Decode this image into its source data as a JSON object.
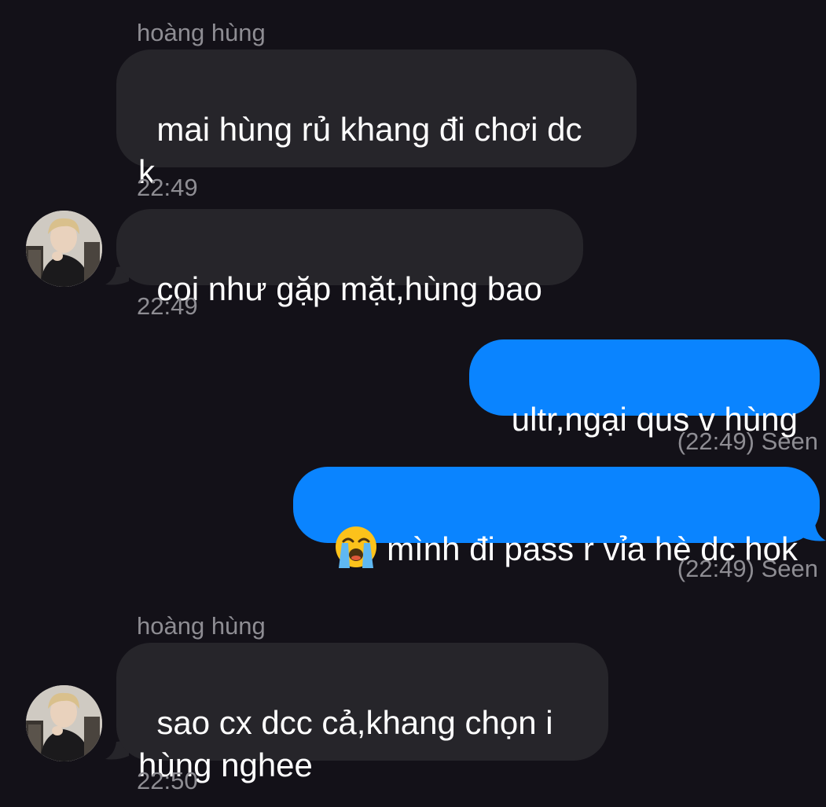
{
  "colors": {
    "background": "#131118",
    "incoming_bubble": "#26252a",
    "outgoing_bubble": "#0a84ff",
    "meta_text": "#8e8d93"
  },
  "messages": [
    {
      "sender": "hoàng hùng",
      "text": "mai hùng rủ khang đi chơi dc\nk",
      "time": "22:49",
      "direction": "incoming"
    },
    {
      "text": "coi như gặp mặt,hùng bao",
      "time": "22:49",
      "direction": "incoming",
      "avatar": "profile-photo"
    },
    {
      "text": "ultr,ngại qus v hùng",
      "status": "(22:49) Seen",
      "direction": "outgoing"
    },
    {
      "emoji": "loudly-crying-face-icon",
      "text": "mình đi pass r vỉa hè dc hok",
      "status": "(22:49) Seen",
      "direction": "outgoing"
    },
    {
      "sender": "hoàng hùng",
      "text": "sao cx dcc cả,khang chọn i\nhùng nghee",
      "time": "22:50",
      "direction": "incoming",
      "avatar": "profile-photo"
    }
  ]
}
